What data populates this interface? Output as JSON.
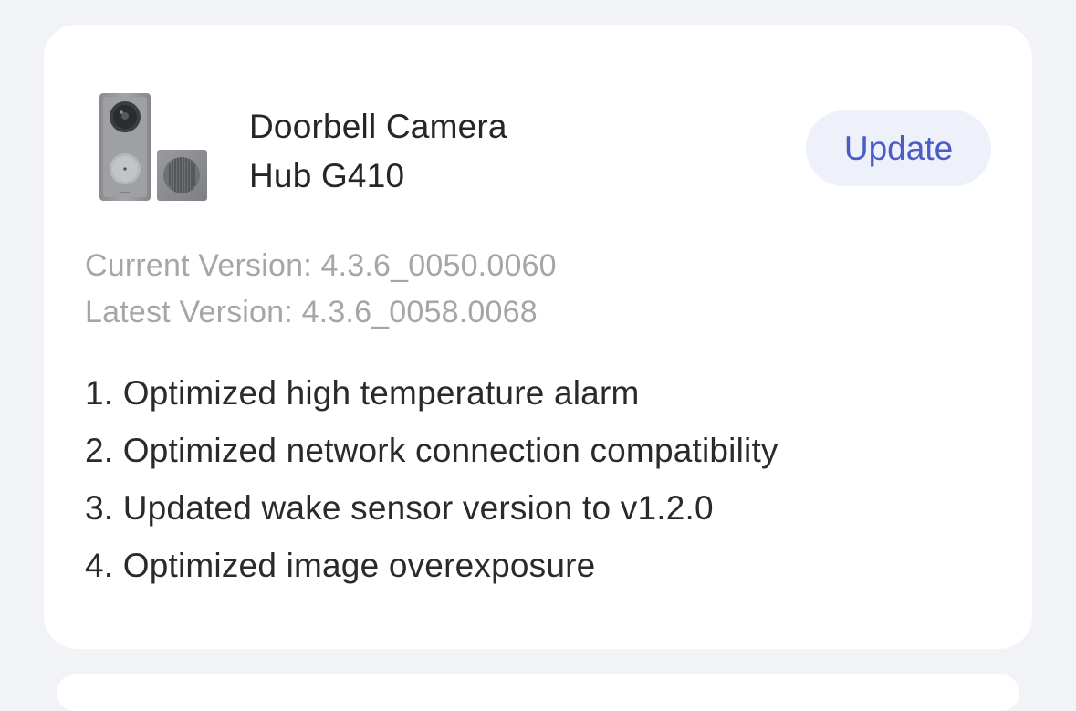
{
  "device": {
    "name_line1": "Doorbell Camera",
    "name_line2": "Hub G410",
    "image": "doorbell-camera-and-chime-image"
  },
  "update_button": {
    "label": "Update"
  },
  "versions": {
    "current": "Current Version: 4.3.6_0050.0060",
    "latest": "Latest Version: 4.3.6_0058.0068"
  },
  "release_notes": [
    "1. Optimized high temperature alarm",
    "2. Optimized network connection compatibility",
    "3. Updated wake sensor version to v1.2.0",
    "4. Optimized image overexposure"
  ],
  "colors": {
    "background": "#f2f3f7",
    "card": "#ffffff",
    "accent": "#4a5cc8",
    "button_bg": "#eef0fa",
    "muted_text": "#a6a6a6"
  }
}
